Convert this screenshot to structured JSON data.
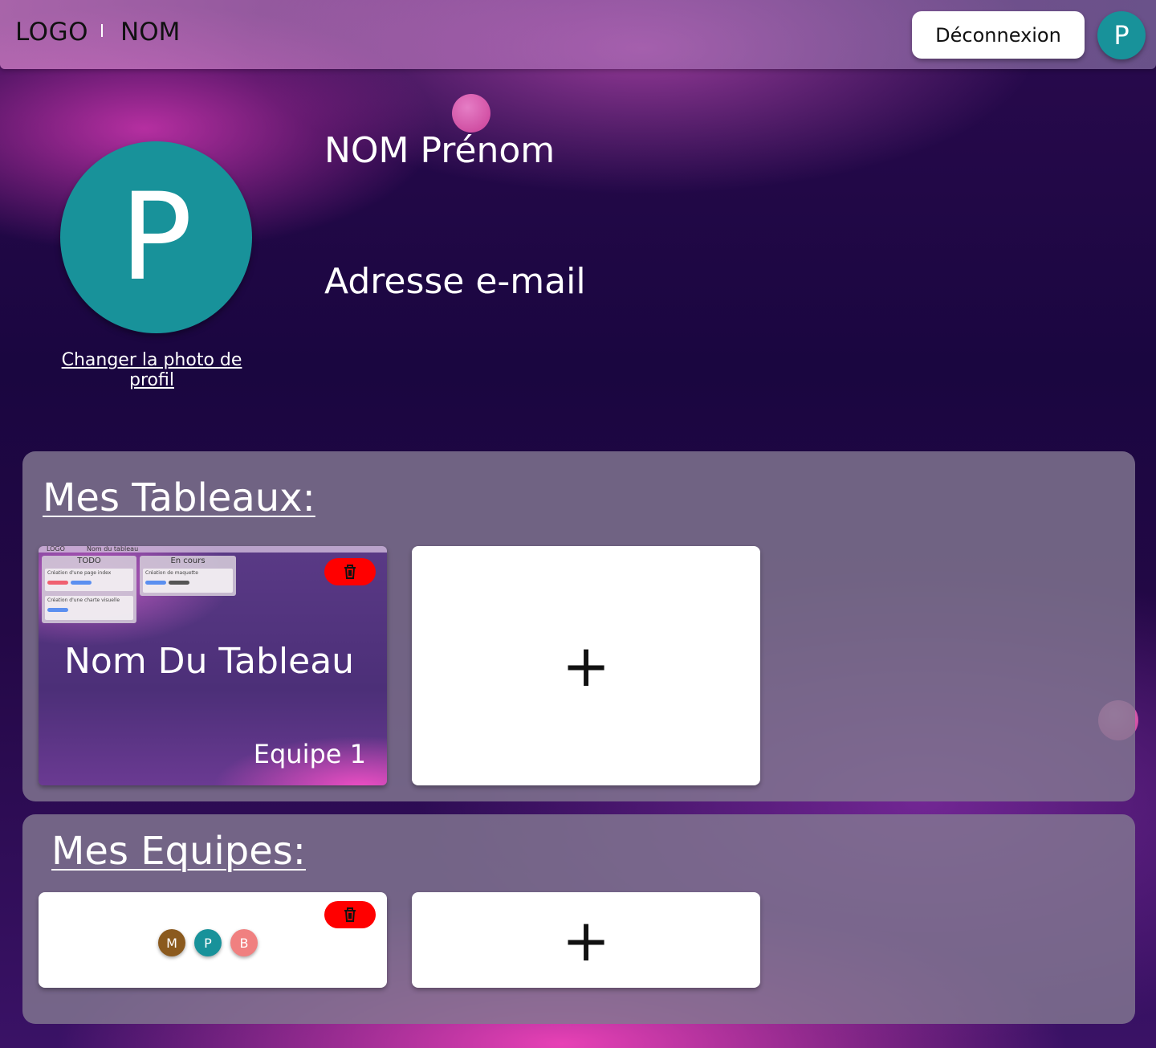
{
  "header": {
    "logo": "LOGO",
    "app_name": "NOM",
    "logout_label": "Déconnexion",
    "avatar_initial": "P"
  },
  "profile": {
    "avatar_initial": "P",
    "change_photo_label": "Changer la photo de profil",
    "full_name": "NOM Prénom",
    "email": "Adresse e-mail"
  },
  "boards": {
    "title": "Mes Tableaux:",
    "items": [
      {
        "name": "Nom Du Tableau",
        "team": "Equipe 1",
        "preview": {
          "logo": "LOGO",
          "board_name": "Nom du tableau",
          "columns": [
            {
              "title": "TODO",
              "cards": [
                "Création d'une page index",
                "Création d'une charte visuelle"
              ]
            },
            {
              "title": "En cours",
              "cards": [
                "Création de maquette"
              ]
            }
          ]
        }
      }
    ],
    "add_label": "+"
  },
  "teams": {
    "title": "Mes Equipes:",
    "items": [
      {
        "members": [
          {
            "initial": "M",
            "color": "#8b5a1e"
          },
          {
            "initial": "P",
            "color": "#18929a"
          },
          {
            "initial": "B",
            "color": "#f08080"
          }
        ]
      }
    ],
    "add_label": "+"
  },
  "colors": {
    "accent": "#18929a",
    "danger": "#ff0000"
  }
}
